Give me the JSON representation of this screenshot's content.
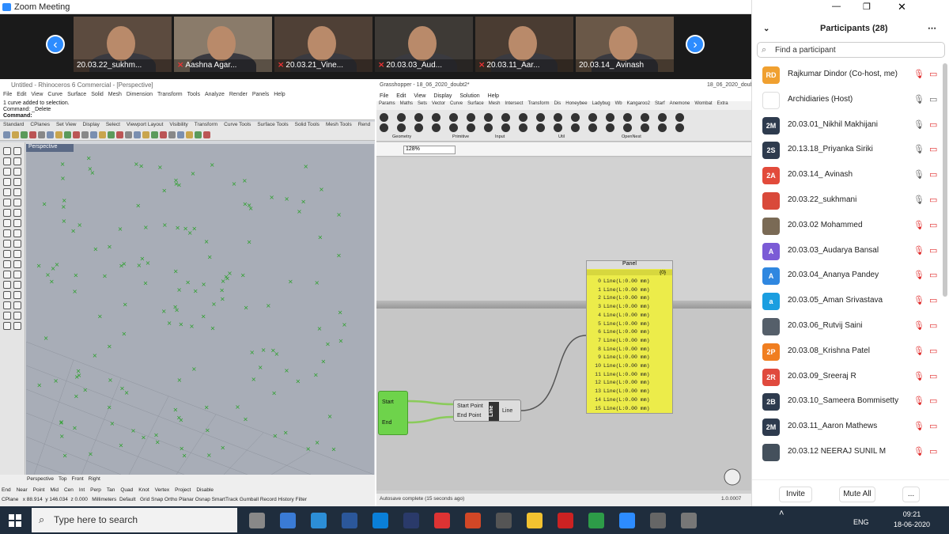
{
  "window": {
    "title": "Zoom Meeting"
  },
  "videos": [
    {
      "name": "20.03.22_sukhm...",
      "muted": false
    },
    {
      "name": "Aashna Agar...",
      "muted": true
    },
    {
      "name": "20.03.21_Vine...",
      "muted": true
    },
    {
      "name": "20.03.03_Aud...",
      "muted": true
    },
    {
      "name": "20.03.11_Aar...",
      "muted": true
    },
    {
      "name": "20.03.14_ Avinash",
      "muted": false
    }
  ],
  "rhino": {
    "title": "Untitled - Rhinoceros 6 Commercial - [Perspective]",
    "menu": [
      "File",
      "Edit",
      "View",
      "Curve",
      "Surface",
      "Solid",
      "Mesh",
      "Dimension",
      "Transform",
      "Tools",
      "Analyze",
      "Render",
      "Panels",
      "Help"
    ],
    "command_lines": [
      "1 curve added to selection.",
      "Command: _Delete",
      "Command:"
    ],
    "toolbar_tabs": [
      "Standard",
      "CPlanes",
      "Set View",
      "Display",
      "Select",
      "Viewport Layout",
      "Visibility",
      "Transform",
      "Curve Tools",
      "Surface Tools",
      "Solid Tools",
      "Mesh Tools",
      "Rend"
    ],
    "viewport_label": "Perspective",
    "view_tabs": [
      "Perspective",
      "Top",
      "Front",
      "Right"
    ],
    "osnaps": [
      "End",
      "Near",
      "Point",
      "Mid",
      "Cen",
      "Int",
      "Perp",
      "Tan",
      "Quad",
      "Knot",
      "Vertex",
      "Project",
      "Disable"
    ],
    "status": {
      "cplane": "CPlane",
      "x": "x 88.914",
      "y": "y 146.034",
      "z": "z 0.000",
      "units": "Millimeters",
      "layer": "Default",
      "items": "Grid Snap  Ortho  Planar  Osnap  SmartTrack  Gumball  Record History  Filter"
    }
  },
  "gh": {
    "title": "Grasshopper - 18_06_2020_doubt2*",
    "doc": "18_06_2020_doubt2",
    "menu": [
      "File",
      "Edit",
      "View",
      "Display",
      "Solution",
      "Help"
    ],
    "tabs": [
      "Params",
      "Maths",
      "Sets",
      "Vector",
      "Curve",
      "Surface",
      "Mesh",
      "Intersect",
      "Transform",
      "Dis",
      "Honeybee",
      "Ladybug",
      "Wb",
      "Kangaroo2",
      "Starf",
      "Anemone",
      "Wombat",
      "Extra"
    ],
    "ribbon_groups": [
      "Geometry",
      "Primitive",
      "Input",
      "Util",
      "OpenNest"
    ],
    "zoom": "128%",
    "panel": {
      "title": "Panel",
      "header": "{0}",
      "rows": [
        "Line(L:0.00 mm)",
        "Line(L:0.00 mm)",
        "Line(L:0.00 mm)",
        "Line(L:0.00 mm)",
        "Line(L:0.00 mm)",
        "Line(L:0.00 mm)",
        "Line(L:0.00 mm)",
        "Line(L:0.00 mm)",
        "Line(L:0.00 mm)",
        "Line(L:0.00 mm)",
        "Line(L:0.00 mm)",
        "Line(L:0.00 mm)",
        "Line(L:0.00 mm)",
        "Line(L:0.00 mm)",
        "Line(L:0.00 mm)",
        "Line(L:0.00 mm)"
      ],
      "indices": [
        "0",
        "1",
        "2",
        "3",
        "4",
        "5",
        "6",
        "7",
        "8",
        "9",
        "10",
        "11",
        "12",
        "13",
        "14",
        "15"
      ]
    },
    "input_params": [
      "Start",
      "End"
    ],
    "line_component": {
      "inputs": [
        "Start Point",
        "End Point"
      ],
      "label": "Line",
      "output": "Line"
    },
    "status": "Autosave complete (15 seconds ago)",
    "version": "1.0.0007"
  },
  "participants": {
    "title": "Participants (28)",
    "search_placeholder": "Find a participant",
    "list": [
      {
        "initials": "RD",
        "color": "#f0a030",
        "name": "Rajkumar Dindor (Co-host, me)",
        "mic_off": true,
        "video_off": true
      },
      {
        "initials": "",
        "color": "#ffffff",
        "name": "Archidiaries (Host)",
        "mic_off": false,
        "video_off": false
      },
      {
        "initials": "2M",
        "color": "#2e3b4e",
        "name": "20.03.01_Nikhil Makhijani",
        "mic_off": false,
        "video_off": true
      },
      {
        "initials": "2S",
        "color": "#2e3b4e",
        "name": "20.13.18_Priyanka Siriki",
        "mic_off": false,
        "video_off": true
      },
      {
        "initials": "2A",
        "color": "#e24b3b",
        "name": "20.03.14_ Avinash",
        "mic_off": false,
        "video_off": true
      },
      {
        "initials": "",
        "color": "#d9493a",
        "name": "20.03.22_sukhmani",
        "mic_off": false,
        "video_off": true
      },
      {
        "initials": "",
        "color": "#7a6a55",
        "name": "20.03.02 Mohammed",
        "mic_off": true,
        "video_off": true
      },
      {
        "initials": "A",
        "color": "#7b5bd6",
        "name": "20.03.03_Audarya Bansal",
        "mic_off": true,
        "video_off": true
      },
      {
        "initials": "A",
        "color": "#2f87e0",
        "name": "20.03.04_Ananya Pandey",
        "mic_off": true,
        "video_off": true
      },
      {
        "initials": "a",
        "color": "#1b9ee0",
        "name": "20.03.05_Aman Srivastava",
        "mic_off": true,
        "video_off": true
      },
      {
        "initials": "",
        "color": "#555f6a",
        "name": "20.03.06_Rutvij Saini",
        "mic_off": true,
        "video_off": true
      },
      {
        "initials": "2P",
        "color": "#f07e20",
        "name": "20.03.08_Krishna Patel",
        "mic_off": true,
        "video_off": true
      },
      {
        "initials": "2R",
        "color": "#e04a3e",
        "name": "20.03.09_Sreeraj R",
        "mic_off": true,
        "video_off": true
      },
      {
        "initials": "2B",
        "color": "#2e3b4e",
        "name": "20.03.10_Sameera Bommisetty",
        "mic_off": true,
        "video_off": true
      },
      {
        "initials": "2M",
        "color": "#2e3b4e",
        "name": "20.03.11_Aaron Mathews",
        "mic_off": true,
        "video_off": true
      },
      {
        "initials": "",
        "color": "#44505c",
        "name": "20.03.12 NEERAJ SUNIL M",
        "mic_off": true,
        "video_off": true
      }
    ],
    "invite_label": "Invite",
    "mute_all_label": "Mute All",
    "more_label": "..."
  },
  "taskbar": {
    "search": "Type here to search",
    "lang": "ENG",
    "time": "09:21",
    "date": "18-06-2020"
  }
}
